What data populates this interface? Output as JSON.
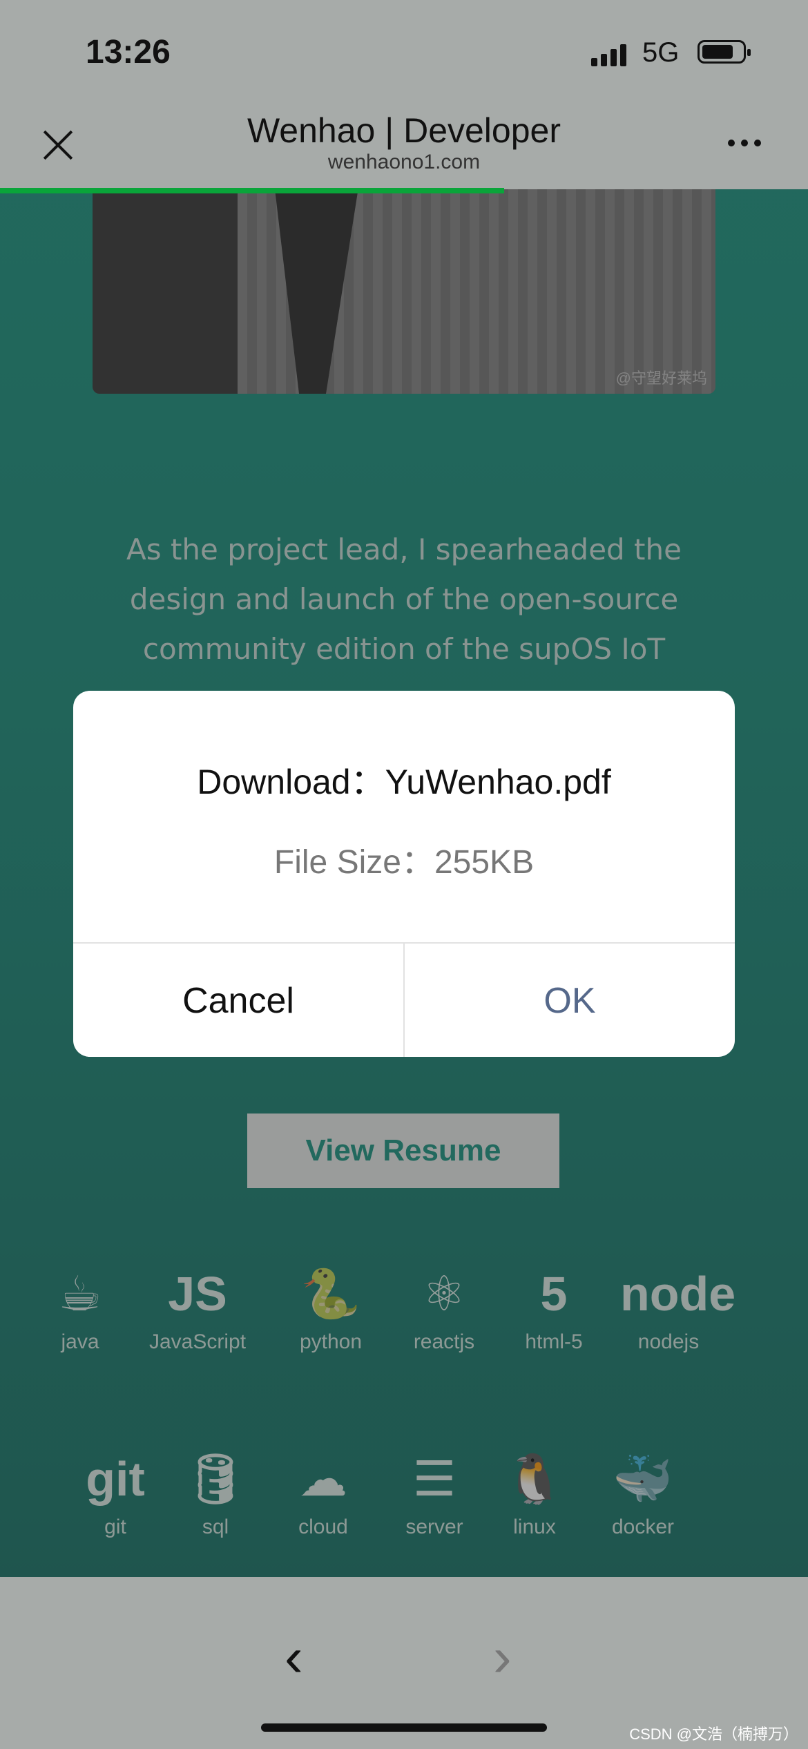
{
  "status": {
    "time": "13:26",
    "network": "5G"
  },
  "navbar": {
    "title": "Wenhao | Developer",
    "host": "wenhaono1.com"
  },
  "page": {
    "watermark": "@守望好莱坞",
    "bio_lines": [
      "As the project lead, I spearheaded the",
      "design and launch of the open-source",
      "community edition of the supOS IoT"
    ],
    "resume_button": "View Resume",
    "skills_row1": [
      {
        "icon": "java-icon",
        "glyph": "☕",
        "label": "java"
      },
      {
        "icon": "javascript-icon",
        "glyph": "JS",
        "label": "JavaScript"
      },
      {
        "icon": "python-icon",
        "glyph": "🐍",
        "label": "python"
      },
      {
        "icon": "react-icon",
        "glyph": "⚛",
        "label": "reactjs"
      },
      {
        "icon": "html5-icon",
        "glyph": "5",
        "label": "html-5"
      },
      {
        "icon": "nodejs-icon",
        "glyph": "node",
        "label": "nodejs"
      }
    ],
    "skills_row2": [
      {
        "icon": "git-icon",
        "glyph": "git",
        "label": "git"
      },
      {
        "icon": "database-icon",
        "glyph": "🛢",
        "label": "sql"
      },
      {
        "icon": "cloud-icon",
        "glyph": "☁",
        "label": "cloud"
      },
      {
        "icon": "server-icon",
        "glyph": "☰",
        "label": "server"
      },
      {
        "icon": "linux-icon",
        "glyph": "🐧",
        "label": "linux"
      },
      {
        "icon": "docker-icon",
        "glyph": "🐳",
        "label": "docker"
      }
    ]
  },
  "dialog": {
    "title": "Download：YuWenhao.pdf",
    "size": "File Size：255KB",
    "cancel": "Cancel",
    "ok": "OK"
  },
  "footer": {
    "credit": "CSDN @文浩（楠搏万）",
    "back": "‹",
    "forward": "›"
  },
  "colors": {
    "accent": "#0d8f7a",
    "progress": "#0aa43a",
    "ok": "#55688a"
  }
}
